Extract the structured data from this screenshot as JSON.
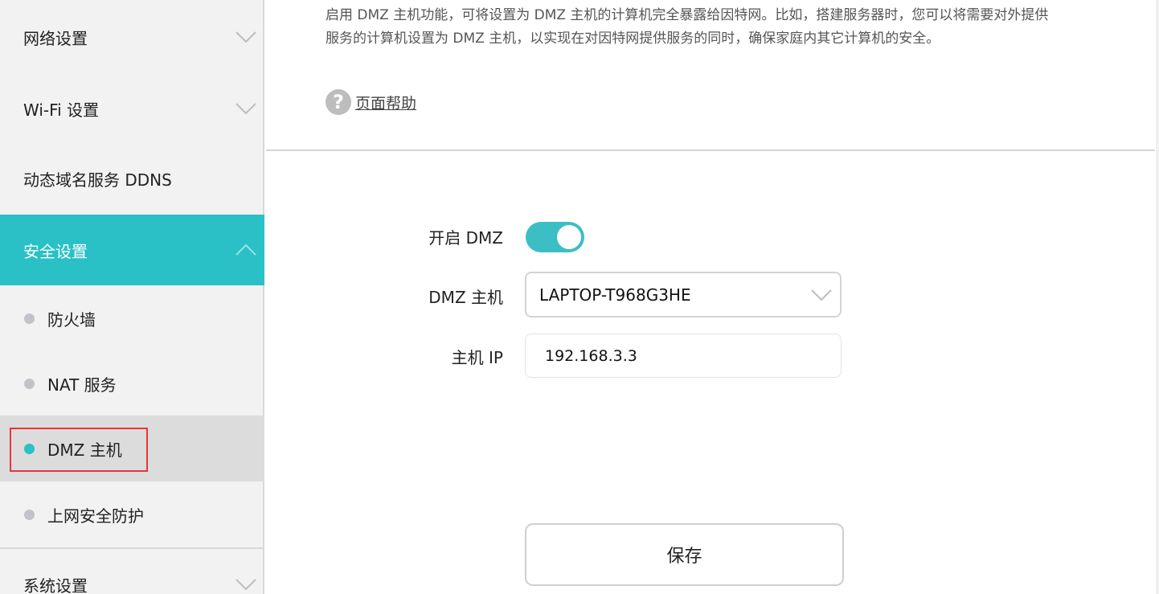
{
  "sidebar": {
    "network_settings": "网络设置",
    "wifi_settings": "Wi-Fi 设置",
    "ddns": "动态域名服务 DDNS",
    "security_settings": "安全设置",
    "sub_items": {
      "firewall": "防火墙",
      "nat": "NAT 服务",
      "dmz": "DMZ 主机",
      "internet_protection": "上网安全防护"
    },
    "system_settings": "系统设置"
  },
  "main": {
    "description_line1": "启用 DMZ 主机功能，可将设置为 DMZ 主机的计算机完全暴露给因特网。比如，搭建服务器时，您可以将需要对外提供",
    "description_line2": "服务的计算机设置为 DMZ 主机，以实现在对因特网提供服务的同时，确保家庭内其它计算机的安全。",
    "help_icon_glyph": "?",
    "help_link": "页面帮助",
    "form": {
      "enable_label": "开启 DMZ",
      "enable_state": "on",
      "host_label": "DMZ 主机",
      "host_value": "LAPTOP-T968G3HE",
      "ip_label": "主机 IP",
      "ip_value": "192.168.3.3"
    },
    "save_label": "保存"
  },
  "colors": {
    "accent": "#29c0c6",
    "highlight_border": "#e8353b"
  }
}
